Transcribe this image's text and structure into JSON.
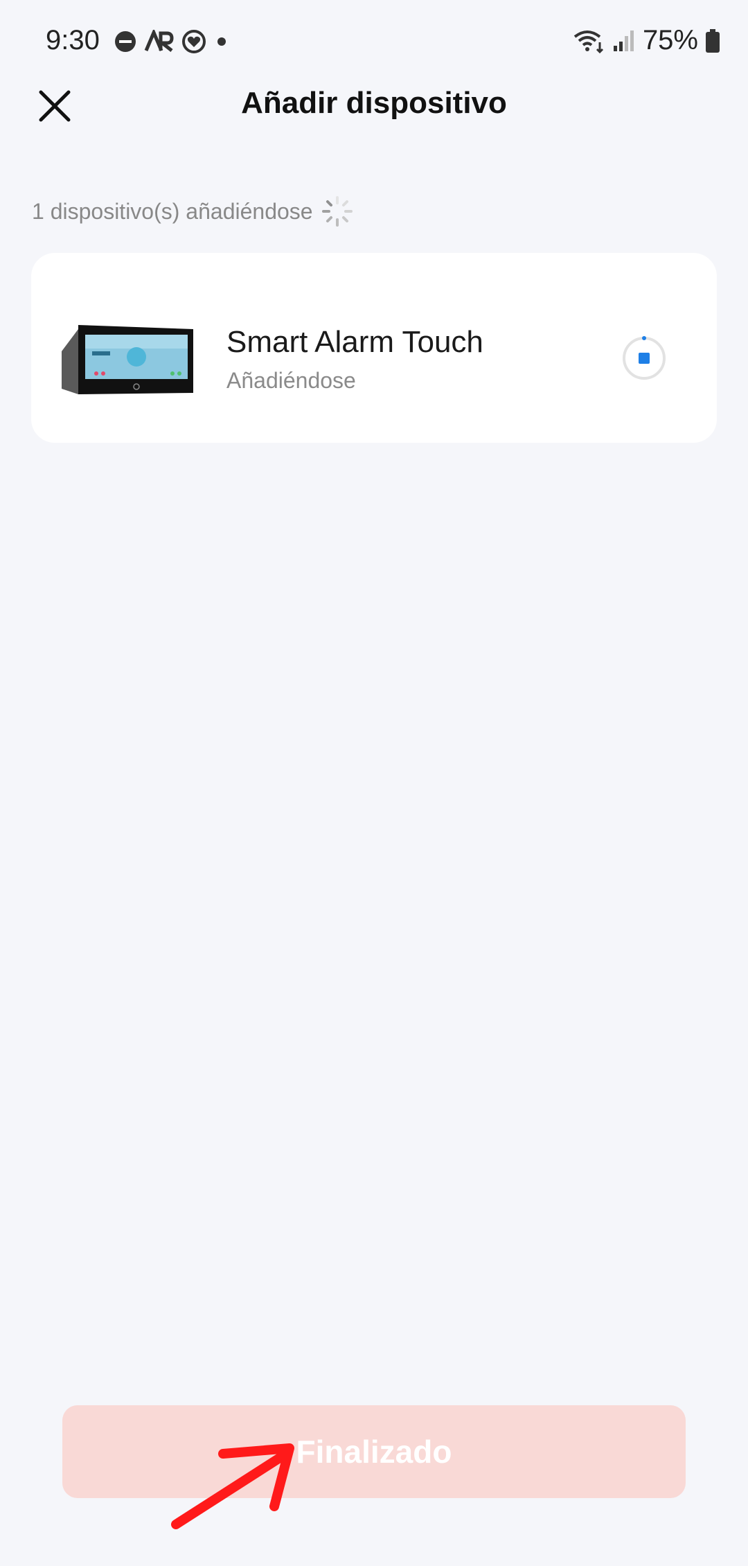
{
  "status_bar": {
    "time": "9:30",
    "battery": "75%",
    "left_icons": [
      "do-not-disturb-icon",
      "ar-icon",
      "health-icon",
      "dot-icon"
    ],
    "right_icons": [
      "wifi-icon",
      "signal-icon",
      "battery-icon"
    ]
  },
  "header": {
    "title": "Añadir dispositivo",
    "close_icon": "close-icon"
  },
  "progress": {
    "text": "1 dispositivo(s) añadiéndose",
    "icon": "spinner-icon"
  },
  "device": {
    "name": "Smart Alarm Touch",
    "status": "Añadiéndose",
    "status_icon": "stop-progress-icon"
  },
  "done_button": {
    "label": "Finalizado",
    "state": "disabled"
  },
  "colors": {
    "background": "#f5f6fa",
    "card": "#ffffff",
    "accent_blue": "#1e7fe6",
    "button_disabled": "#f9d9d6",
    "annotation_red": "#ff1a1a"
  }
}
